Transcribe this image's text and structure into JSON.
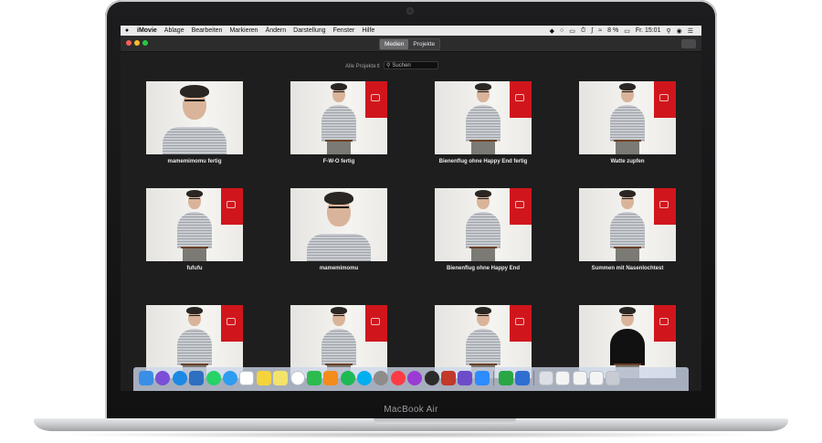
{
  "device": {
    "label": "MacBook Air"
  },
  "menubar": {
    "app": "iMovie",
    "items": [
      "Ablage",
      "Bearbeiten",
      "Markieren",
      "Ändern",
      "Darstellung",
      "Fenster",
      "Hilfe"
    ],
    "battery": "8 %",
    "clock": "Fr. 15:01"
  },
  "toolbar": {
    "tabs": [
      {
        "label": "Medien",
        "active": true
      },
      {
        "label": "Projekte",
        "active": false
      }
    ]
  },
  "browser": {
    "filter_label": "Alle Projekte",
    "search_placeholder": "Suchen"
  },
  "projects": [
    {
      "title": "mamemimomu fertig",
      "shot": "closeup"
    },
    {
      "title": "F-W-O fertig",
      "shot": "half"
    },
    {
      "title": "Bienenflug ohne Happy End fertig",
      "shot": "half"
    },
    {
      "title": "Watte zupfen",
      "shot": "half"
    },
    {
      "title": "fufufu",
      "shot": "half"
    },
    {
      "title": "mamemimomu",
      "shot": "closeup"
    },
    {
      "title": "Bienenflug ohne Happy End",
      "shot": "half"
    },
    {
      "title": "Summen mit Nasenlochtest",
      "shot": "half"
    },
    {
      "title": "",
      "shot": "half"
    },
    {
      "title": "",
      "shot": "half"
    },
    {
      "title": "",
      "shot": "half"
    },
    {
      "title": "",
      "shot": "half-black"
    }
  ],
  "dock": {
    "icons": [
      "finder-icon",
      "siri-icon",
      "safari-icon",
      "preview-icon",
      "whatsapp-icon",
      "messages-icon",
      "calendar-icon",
      "notes-icon",
      "stickies-icon",
      "photos-icon",
      "facetime-icon",
      "pages-icon",
      "spotify-icon",
      "skype-icon",
      "system-preferences-icon",
      "music-icon",
      "podcasts-icon",
      "logic-icon",
      "photo-booth-icon",
      "imovie-icon",
      "zoom-icon",
      "numbers-icon",
      "keynote-icon",
      "finder-window-icon",
      "document-icon",
      "document-icon",
      "document-icon",
      "trash-icon"
    ],
    "colors": [
      "#3a8ee6",
      "#7b4fd6",
      "#1e88e5",
      "#2e6fc1",
      "#25d366",
      "#2e9cf0",
      "#ffffff",
      "#f5d33b",
      "#f2e46a",
      "#ffffff",
      "#2dbb4f",
      "#f38c1c",
      "#1db954",
      "#00aff0",
      "#8c8c8c",
      "#fc3c44",
      "#9b3bd6",
      "#2b2b2b",
      "#c0392b",
      "#6c4cc9",
      "#2d8cff",
      "#29a745",
      "#2f6fd1",
      "#dcdfe5",
      "#f4f4f4",
      "#f4f4f4",
      "#f4f4f4",
      "#c8ccd2"
    ]
  }
}
